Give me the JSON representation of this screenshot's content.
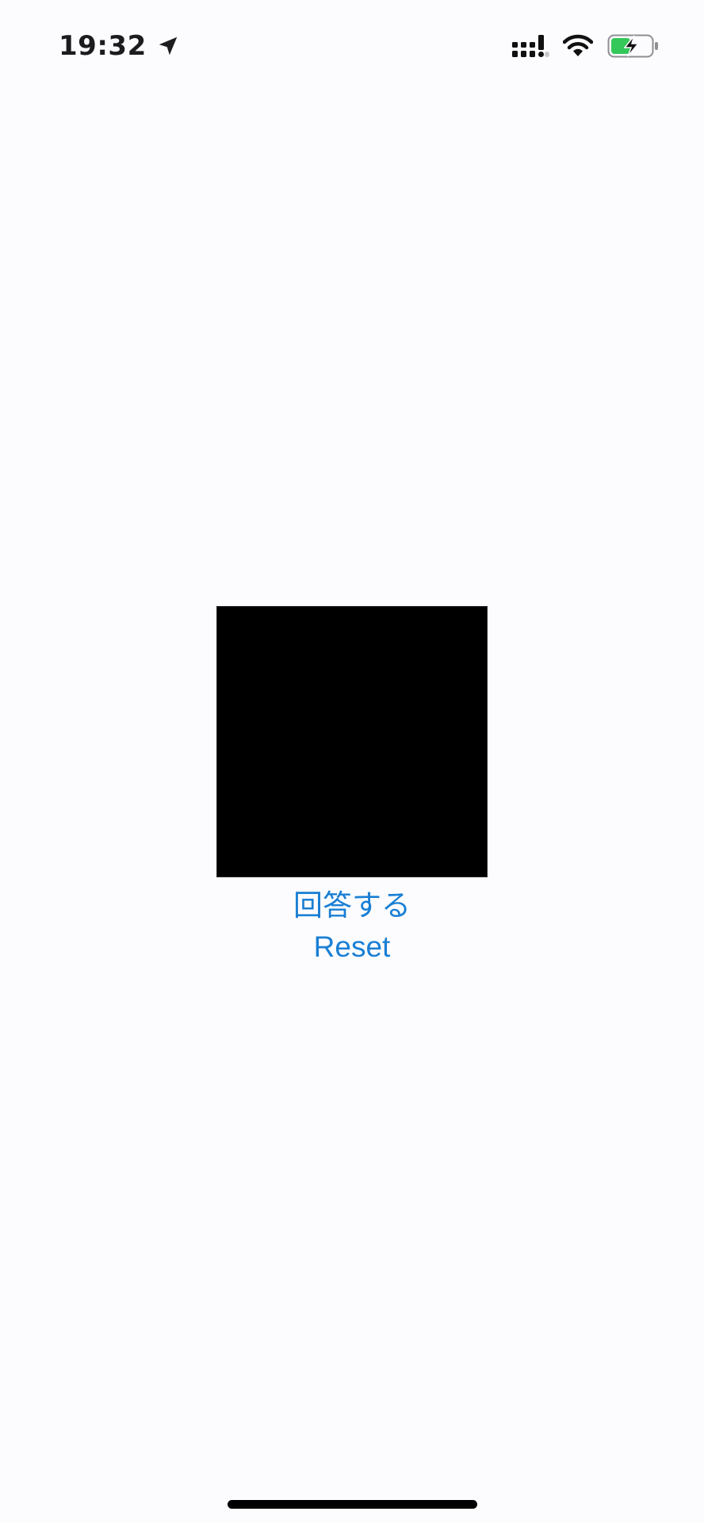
{
  "status_bar": {
    "time": "19:32",
    "icons": [
      "location-arrow-icon",
      "cellular-signal-icon",
      "wifi-icon",
      "battery-charging-icon"
    ],
    "battery_color": "#34c759"
  },
  "main": {
    "square_color": "#000000",
    "answer_label": "回答する",
    "reset_label": "Reset",
    "accent_color": "#1a7fd4"
  }
}
